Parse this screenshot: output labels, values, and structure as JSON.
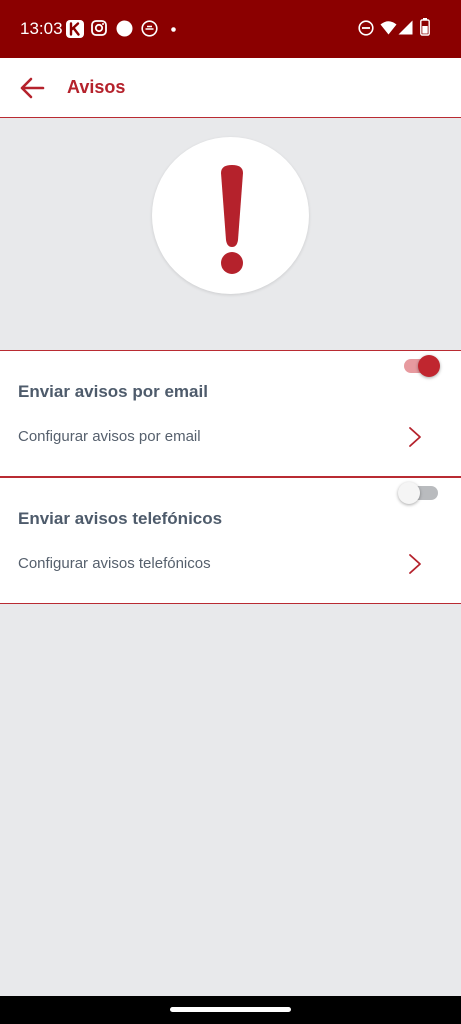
{
  "status_bar": {
    "time": "13:03",
    "left_icons": [
      "k-app-icon",
      "instagram-icon",
      "circle-icon",
      "chat-icon",
      "dot-icon"
    ],
    "right_icons": [
      "dnd-icon",
      "wifi-icon",
      "signal-icon",
      "battery-icon"
    ],
    "background": "#8b0000"
  },
  "header": {
    "title": "Avisos",
    "back_icon": "arrow-left-icon",
    "accent": "#b5222c"
  },
  "hero": {
    "icon": "exclamation-icon",
    "icon_color": "#b5222c"
  },
  "sections": [
    {
      "title": "Enviar avisos por email",
      "toggle_on": true,
      "link_label": "Configurar avisos por email"
    },
    {
      "title": "Enviar avisos telefónicos",
      "toggle_on": false,
      "link_label": "Configurar avisos telefónicos"
    }
  ]
}
